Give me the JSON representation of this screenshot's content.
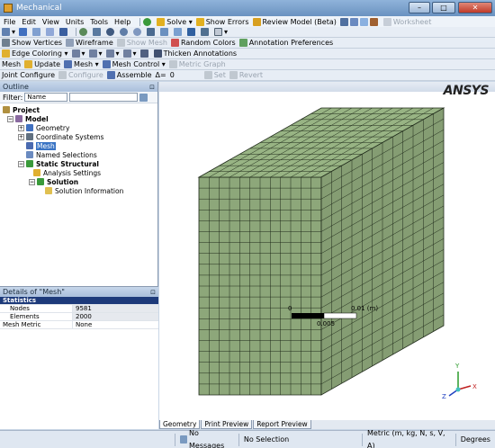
{
  "window": {
    "title": "Mechanical"
  },
  "menu": [
    "File",
    "Edit",
    "View",
    "Units",
    "Tools",
    "Help"
  ],
  "toolbar1": {
    "solve": "Solve",
    "show_errors": "Show Errors",
    "review_model": "Review Model (Beta)",
    "worksheet": "Worksheet"
  },
  "toolbar3": {
    "show_vertices": "Show Vertices",
    "wireframe": "Wireframe",
    "show_mesh": "Show Mesh",
    "random_colors": "Random Colors",
    "annotation_prefs": "Annotation Preferences"
  },
  "toolbar4": {
    "edge_coloring": "Edge Coloring",
    "thicken": "Thicken Annotations"
  },
  "toolbar5": {
    "mesh": "Mesh",
    "update": "Update",
    "mesh_menu": "Mesh",
    "mesh_control": "Mesh Control",
    "metric_graph": "Metric Graph"
  },
  "toolbar6": {
    "joint_configure": "Joint Configure",
    "configure": "Configure",
    "assemble": "Assemble",
    "delta_label": "Δ=",
    "delta_value": "0",
    "set": "Set",
    "revert": "Revert"
  },
  "outline": {
    "header": "Outline",
    "filter_label": "Filter:",
    "filter_value": "Name",
    "nodes": [
      "Project",
      "Model",
      "Geometry",
      "Coordinate Systems",
      "Mesh",
      "Named Selections",
      "Static Structural",
      "Analysis Settings",
      "Solution",
      "Solution Information"
    ]
  },
  "details": {
    "header": "Details of \"Mesh\"",
    "group": "Statistics",
    "rows": [
      {
        "k": "Nodes",
        "v": "9581"
      },
      {
        "k": "Elements",
        "v": "2000"
      },
      {
        "k": "Mesh Metric",
        "v": "None"
      }
    ]
  },
  "viewport": {
    "logo": "ANSYS",
    "scale": {
      "zero": "0",
      "max": "0.01 (m)",
      "mid": "0.005"
    },
    "triad": {
      "x": "X",
      "y": "Y",
      "z": "Z"
    }
  },
  "tabs": [
    "Geometry",
    "Print Preview",
    "Report Preview"
  ],
  "status": {
    "messages": "No Messages",
    "selection": "No Selection",
    "units": "Metric (m, kg, N, s, V, A)",
    "angle": "Degrees"
  },
  "colors": {
    "mesh_fill": "#8da77a",
    "mesh_line": "#1f2a1a",
    "accent": "#3a74c4"
  }
}
